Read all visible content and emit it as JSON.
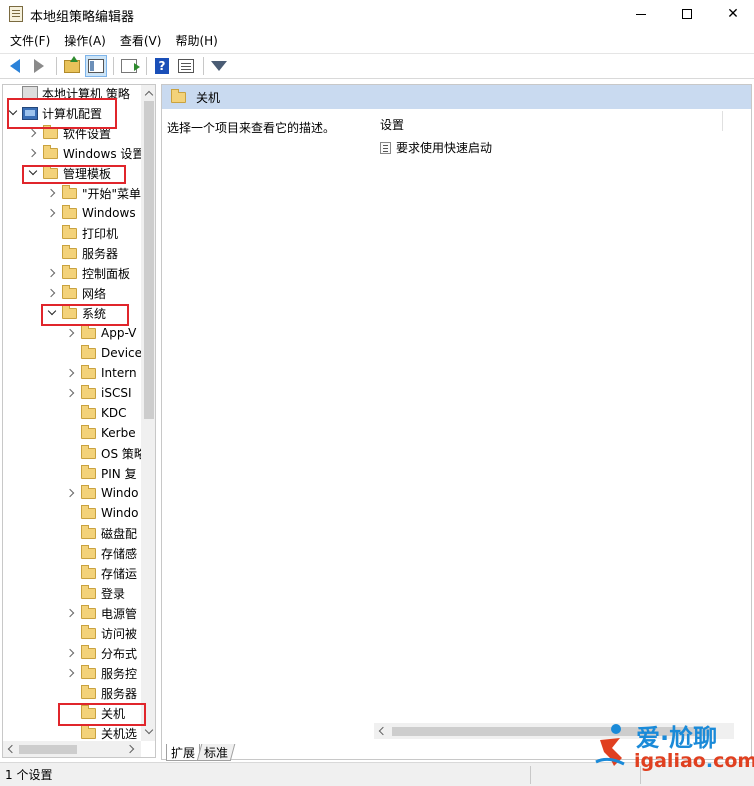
{
  "window": {
    "title": "本地组策略编辑器",
    "min_label": "─",
    "max_label": "☐",
    "close_label": "✕"
  },
  "menu": [
    "文件(F)",
    "操作(A)",
    "查看(V)",
    "帮助(H)"
  ],
  "toolbar": {
    "icons": [
      "back-arrow-icon",
      "forward-arrow-icon",
      "folder-up-icon",
      "show-hide-tree-icon",
      "export-list-icon",
      "help-icon",
      "properties-icon",
      "filter-icon"
    ]
  },
  "tree": {
    "items": [
      {
        "label": "本地计算机 策略",
        "level": 0,
        "caret": "none",
        "icon": "policy"
      },
      {
        "label": "计算机配置",
        "level": 0,
        "caret": "down",
        "icon": "computer"
      },
      {
        "label": "软件设置",
        "level": 1,
        "caret": "right",
        "icon": "folder"
      },
      {
        "label": "Windows 设置",
        "level": 1,
        "caret": "right",
        "icon": "folder"
      },
      {
        "label": "管理模板",
        "level": 1,
        "caret": "down",
        "icon": "folder"
      },
      {
        "label": "\"开始\"菜单",
        "level": 2,
        "caret": "right",
        "icon": "folder"
      },
      {
        "label": "Windows",
        "level": 2,
        "caret": "right",
        "icon": "folder"
      },
      {
        "label": "打印机",
        "level": 2,
        "caret": "none",
        "icon": "folder"
      },
      {
        "label": "服务器",
        "level": 2,
        "caret": "none",
        "icon": "folder"
      },
      {
        "label": "控制面板",
        "level": 2,
        "caret": "right",
        "icon": "folder"
      },
      {
        "label": "网络",
        "level": 2,
        "caret": "right",
        "icon": "folder"
      },
      {
        "label": "系统",
        "level": 2,
        "caret": "down",
        "icon": "folder"
      },
      {
        "label": "App-V",
        "level": 3,
        "caret": "right",
        "icon": "folder"
      },
      {
        "label": "Device",
        "level": 3,
        "caret": "none",
        "icon": "folder"
      },
      {
        "label": "Intern",
        "level": 3,
        "caret": "right",
        "icon": "folder"
      },
      {
        "label": "iSCSI",
        "level": 3,
        "caret": "right",
        "icon": "folder"
      },
      {
        "label": "KDC",
        "level": 3,
        "caret": "none",
        "icon": "folder"
      },
      {
        "label": "Kerbe",
        "level": 3,
        "caret": "none",
        "icon": "folder"
      },
      {
        "label": "OS 策略",
        "level": 3,
        "caret": "none",
        "icon": "folder"
      },
      {
        "label": "PIN 复",
        "level": 3,
        "caret": "none",
        "icon": "folder"
      },
      {
        "label": "Windo",
        "level": 3,
        "caret": "right",
        "icon": "folder"
      },
      {
        "label": "Windo",
        "level": 3,
        "caret": "none",
        "icon": "folder"
      },
      {
        "label": "磁盘配",
        "level": 3,
        "caret": "none",
        "icon": "folder"
      },
      {
        "label": "存储感",
        "level": 3,
        "caret": "none",
        "icon": "folder"
      },
      {
        "label": "存储运",
        "level": 3,
        "caret": "none",
        "icon": "folder"
      },
      {
        "label": "登录",
        "level": 3,
        "caret": "none",
        "icon": "folder"
      },
      {
        "label": "电源管",
        "level": 3,
        "caret": "right",
        "icon": "folder"
      },
      {
        "label": "访问被",
        "level": 3,
        "caret": "none",
        "icon": "folder"
      },
      {
        "label": "分布式",
        "level": 3,
        "caret": "right",
        "icon": "folder"
      },
      {
        "label": "服务控",
        "level": 3,
        "caret": "right",
        "icon": "folder"
      },
      {
        "label": "服务器",
        "level": 3,
        "caret": "none",
        "icon": "folder"
      },
      {
        "label": "关机",
        "level": 3,
        "caret": "none",
        "icon": "folder"
      },
      {
        "label": "关机选",
        "level": 3,
        "caret": "none",
        "icon": "folder"
      }
    ]
  },
  "right": {
    "header_title": "关机",
    "description": "选择一个项目来查看它的描述。",
    "column_header": "设置",
    "settings": [
      "要求使用快速启动"
    ],
    "tabs": [
      "扩展",
      "标准"
    ]
  },
  "status": {
    "text": "1 个设置"
  },
  "watermark": {
    "main": "爱·尬聊",
    "sub_left": "igaliao",
    "sub_dot": ".",
    "sub_right": "com"
  },
  "colors": {
    "highlight_box": "#e0252b",
    "header_bg": "#c9daf0"
  }
}
